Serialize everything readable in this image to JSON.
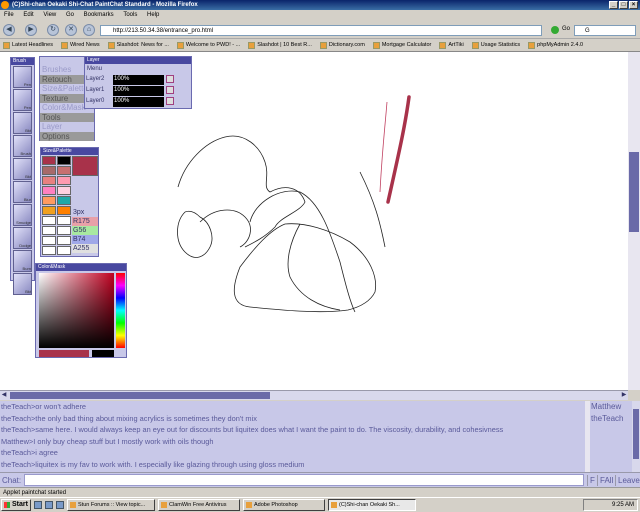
{
  "window": {
    "title": "(C)Shi-chan Oekaki Shi-Chat PaintChat Standard - Mozilla Firefox",
    "controls": [
      "_",
      "□",
      "×"
    ]
  },
  "menu": [
    "File",
    "Edit",
    "View",
    "Go",
    "Bookmarks",
    "Tools",
    "Help"
  ],
  "nav": {
    "url": "http://213.50.34.38/entrance_pro.html",
    "go_label": "Go",
    "search_value": "G"
  },
  "bookmarks": [
    "Latest Headlines",
    "Wired News",
    "Slashdot: News for ...",
    "Welcome to PWD! - ...",
    "Slashdot | 10 Best R...",
    "Dictionary.com",
    "Mortgage Calculator",
    "ArtTiki",
    "Usage Statistics",
    "phpMyAdmin 2.4.0"
  ],
  "tools": {
    "title": "Brush",
    "items": [
      "Pen",
      "Pen",
      "Bkt",
      "Brush",
      "Bkt",
      "Blur",
      "Smudge",
      "Dodge",
      "Burn",
      "Bkt",
      "Mask"
    ]
  },
  "brushes": {
    "items": [
      "Brushes",
      "Retouch",
      "Size&Palette",
      "Texture",
      "Color&Mask",
      "Tools",
      "Layer",
      "Options"
    ],
    "dark_indices": [
      1,
      3,
      5,
      7
    ]
  },
  "layer": {
    "title": "Layer",
    "menu_label": "Menu",
    "rows": [
      {
        "name": "Layer2",
        "opacity": "100%"
      },
      {
        "name": "Layer1",
        "opacity": "100%"
      },
      {
        "name": "Layer0",
        "opacity": "100%"
      }
    ]
  },
  "size_palette": {
    "title": "Size&Palette",
    "swatches": [
      "#a8324a",
      "#000000",
      "#a86a6a",
      "#c87070",
      "#e88080",
      "#ff9ab0",
      "#ff80c0",
      "#ffd0e0",
      "#ff9a60",
      "#20a8a8",
      "#f0a020",
      "#ff8000",
      "#ffffff",
      "#ffffff",
      "#ffffff",
      "#ffffff",
      "#ffffff",
      "#ffffff",
      "#ffffff",
      "#ffffff"
    ],
    "size": "3px",
    "r": "R175",
    "g": "G56",
    "b": "B74",
    "a": "A255"
  },
  "color_mask": {
    "title": "Color&Mask"
  },
  "chat": {
    "messages": [
      "theTeach>or won't adhere",
      "theTeach>the only bad thing about mixing acrylics is sometimes they don't mix",
      "theTeach>same here. I would always keep an eye out for discounts but liquitex does what I want the paint to do. The viscosity, durability, and cohesivness",
      "Matthew>I only buy cheap stuff but I mostly work with oils though",
      "theTeach>i agree",
      "theTeach>liquitex is my fav to work with. I especially like glazing through using gloss medium"
    ],
    "users": [
      "Matthew",
      "theTeach"
    ],
    "input_label": "Chat:",
    "input_value": "",
    "buttons": [
      "F",
      "FAll",
      "Leave"
    ]
  },
  "status": "Applet paintchat started",
  "taskbar": {
    "start": "Start",
    "tasks": [
      "Stun Forums :: View topic...",
      "ClamWin Free Antivirus",
      "Adobe Photoshop",
      "(C)Shi-chan Oekaki Sh..."
    ],
    "active_index": 3,
    "clock": "9:25 AM"
  },
  "colors": {
    "accent": "#4848a0",
    "panel": "#c8c8e8",
    "stroke_red": "#a8324a",
    "chat_text": "#5a5a9a"
  }
}
